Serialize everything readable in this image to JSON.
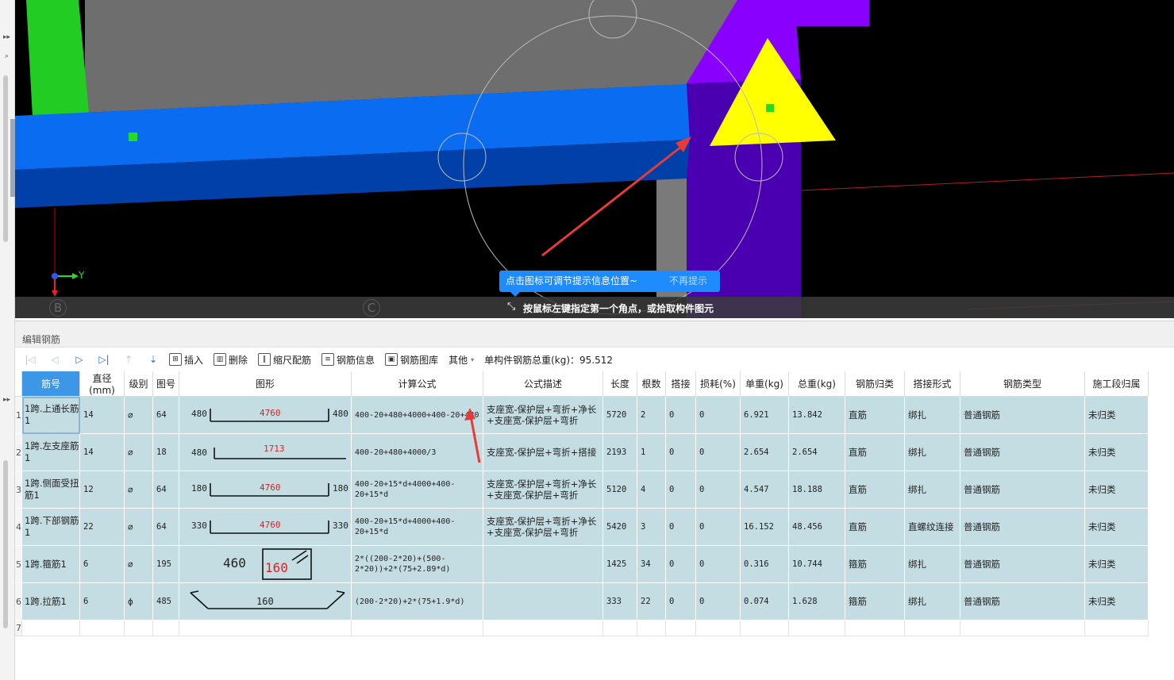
{
  "viewport": {
    "tip_text": "点击图标可调节提示信息位置~",
    "tip_dismiss": "不再提示",
    "status_text": "按鼠标左键指定第一个角点，或拾取构件图元",
    "axis_y_label": "Y",
    "grid_axis_b": "B",
    "grid_axis_c": "C"
  },
  "panel": {
    "title": "编辑钢筋",
    "toolbar": {
      "insert": "插入",
      "delete": "删除",
      "scale_rebar": "缩尺配筋",
      "rebar_info": "钢筋信息",
      "rebar_library": "钢筋图库",
      "other": "其他",
      "total_weight_label": "单构件钢筋总重(kg)：",
      "total_weight_value": "95.512"
    },
    "columns": [
      "筋号",
      "直径(mm)",
      "级别",
      "图号",
      "图形",
      "计算公式",
      "公式描述",
      "长度",
      "根数",
      "搭接",
      "损耗(%)",
      "单重(kg)",
      "总重(kg)",
      "钢筋归类",
      "搭接形式",
      "钢筋类型",
      "施工段归属"
    ],
    "rows": [
      {
        "row_no": "1",
        "name": "1跨.上通长筋1",
        "diameter": "14",
        "grade": "⌀",
        "fig_no": "64",
        "shape": {
          "left": "480",
          "mid": "4760",
          "right": "480"
        },
        "formula": "400-20+480+4000+400-20+480",
        "desc": "支座宽-保护层+弯折+净长+支座宽-保护层+弯折",
        "length": "5720",
        "count": "2",
        "lap": "0",
        "loss": "0",
        "unit_weight": "6.921",
        "total_weight": "13.842",
        "category": "直筋",
        "lap_type": "绑扎",
        "rebar_type": "普通钢筋",
        "stage": "未归类"
      },
      {
        "row_no": "2",
        "name": "1跨.左支座筋1",
        "diameter": "14",
        "grade": "⌀",
        "fig_no": "18",
        "shape": {
          "left": "480",
          "mid": "1713",
          "right": ""
        },
        "formula": "400-20+480+4000/3",
        "desc": "支座宽-保护层+弯折+搭接",
        "length": "2193",
        "count": "1",
        "lap": "0",
        "loss": "0",
        "unit_weight": "2.654",
        "total_weight": "2.654",
        "category": "直筋",
        "lap_type": "绑扎",
        "rebar_type": "普通钢筋",
        "stage": "未归类"
      },
      {
        "row_no": "3",
        "name": "1跨.侧面受扭筋1",
        "diameter": "12",
        "grade": "⌀",
        "fig_no": "64",
        "shape": {
          "left": "180",
          "mid": "4760",
          "right": "180"
        },
        "formula": "400-20+15*d+4000+400-20+15*d",
        "desc": "支座宽-保护层+弯折+净长+支座宽-保护层+弯折",
        "length": "5120",
        "count": "4",
        "lap": "0",
        "loss": "0",
        "unit_weight": "4.547",
        "total_weight": "18.188",
        "category": "直筋",
        "lap_type": "绑扎",
        "rebar_type": "普通钢筋",
        "stage": "未归类"
      },
      {
        "row_no": "4",
        "name": "1跨.下部钢筋1",
        "diameter": "22",
        "grade": "⌀",
        "fig_no": "64",
        "shape": {
          "left": "330",
          "mid": "4760",
          "right": "330"
        },
        "formula": "400-20+15*d+4000+400-20+15*d",
        "desc": "支座宽-保护层+弯折+净长+支座宽-保护层+弯折",
        "length": "5420",
        "count": "3",
        "lap": "0",
        "loss": "0",
        "unit_weight": "16.152",
        "total_weight": "48.456",
        "category": "直筋",
        "lap_type": "直螺纹连接",
        "rebar_type": "普通钢筋",
        "stage": "未归类"
      },
      {
        "row_no": "5",
        "name": "1跨.箍筋1",
        "diameter": "6",
        "grade": "⌀",
        "fig_no": "195",
        "shape": {
          "left": "460",
          "mid": "160",
          "right": ""
        },
        "formula": "2*((200-2*20)+(500-2*20))+2*(75+2.89*d)",
        "desc": "",
        "length": "1425",
        "count": "34",
        "lap": "0",
        "loss": "0",
        "unit_weight": "0.316",
        "total_weight": "10.744",
        "category": "箍筋",
        "lap_type": "绑扎",
        "rebar_type": "普通钢筋",
        "stage": "未归类"
      },
      {
        "row_no": "6",
        "name": "1跨.拉筋1",
        "diameter": "6",
        "grade": "ф",
        "fig_no": "485",
        "shape": {
          "left": "",
          "mid": "160",
          "right": ""
        },
        "formula": "(200-2*20)+2*(75+1.9*d)",
        "desc": "",
        "length": "333",
        "count": "22",
        "lap": "0",
        "loss": "0",
        "unit_weight": "0.074",
        "total_weight": "1.628",
        "category": "箍筋",
        "lap_type": "绑扎",
        "rebar_type": "普通钢筋",
        "stage": "未归类"
      }
    ],
    "empty_row_no": "7"
  },
  "colors": {
    "beam_blue": "#0a6cf0",
    "beam_blue_dark": "#0040a8",
    "column_purple": "#5a00c8",
    "column_purple_light": "#8a00ff",
    "slab_gray": "#6e6e6e",
    "column_green": "#22cc22",
    "triangle_yellow": "#ffff00",
    "tip_blue": "#1e8bff",
    "grid_cell": "#c3dde3",
    "header_selected": "#3d96e6",
    "annotation_red": "#e83a3a",
    "shape_value_red": "#e02020"
  }
}
